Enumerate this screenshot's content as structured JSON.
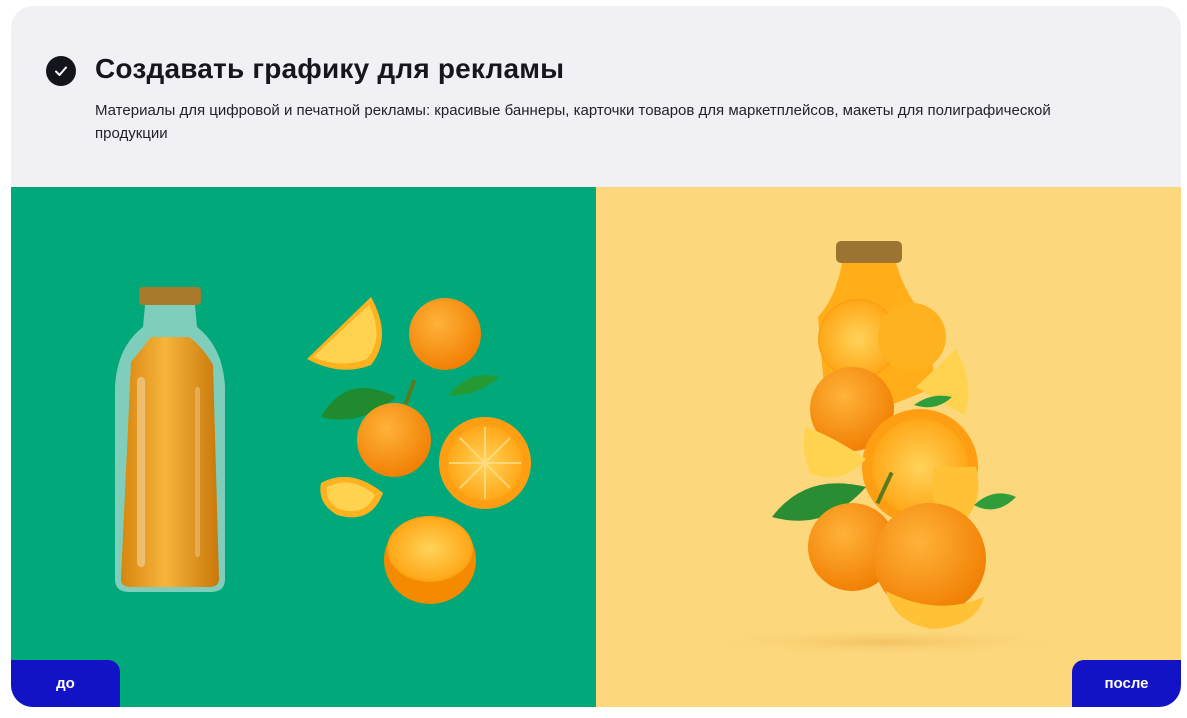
{
  "feature": {
    "icon": "check-circle-icon",
    "title": "Создавать графику для рекламы",
    "description": "Материалы для цифровой и печатной рекламы: красивые баннеры, карточки товаров для маркетплейсов, макеты для полиграфической продукции"
  },
  "comparison": {
    "before_label": "до",
    "after_label": "после",
    "before_bg": "#00a87a",
    "after_bg": "#fdd77c",
    "tag_color": "#1212c7"
  }
}
